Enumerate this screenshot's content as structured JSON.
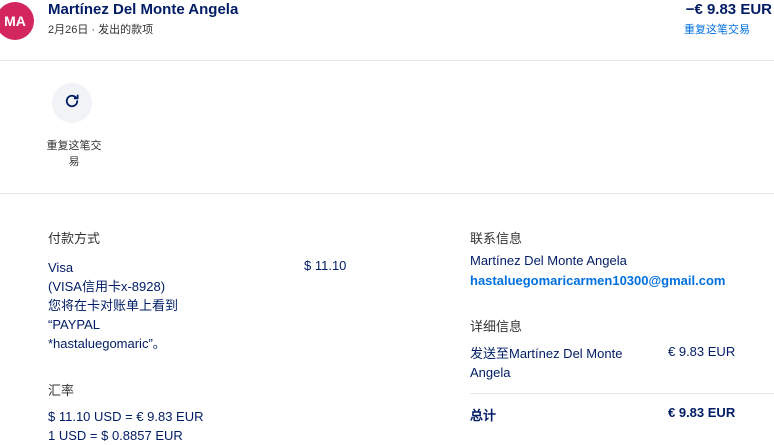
{
  "header": {
    "avatar_initials": "MA",
    "merchant_name": "Martínez Del Monte Angela",
    "subline": "2月26日 · 发出的款项",
    "amount": "−€ 9.83 EUR",
    "repeat_link": "重复这笔交易"
  },
  "action": {
    "icon": "refresh-icon",
    "label": "重复这笔交易"
  },
  "payment_method": {
    "title": "付款方式",
    "lines": [
      "Visa",
      "(VISA信用卡x-8928)",
      "您将在卡对账单上看到",
      "“PAYPAL",
      "*hastaluegomaric”。"
    ],
    "amount": "$ 11.10"
  },
  "exchange_rate": {
    "title": "汇率",
    "lines": [
      "$ 11.10 USD = € 9.83 EUR",
      "1 USD = $ 0.8857 EUR"
    ]
  },
  "contact": {
    "title": "联系信息",
    "name": "Martínez Del Monte Angela",
    "email": "hastaluegomaricarmen10300@gmail.com"
  },
  "details": {
    "title": "详细信息",
    "description": "发送至Martínez Del Monte Angela",
    "amount": "€ 9.83 EUR",
    "total_label": "总计",
    "total_amount": "€ 9.83 EUR"
  },
  "colors": {
    "avatar": "#d3265f",
    "link": "#0070e0",
    "text": "#001c64"
  }
}
